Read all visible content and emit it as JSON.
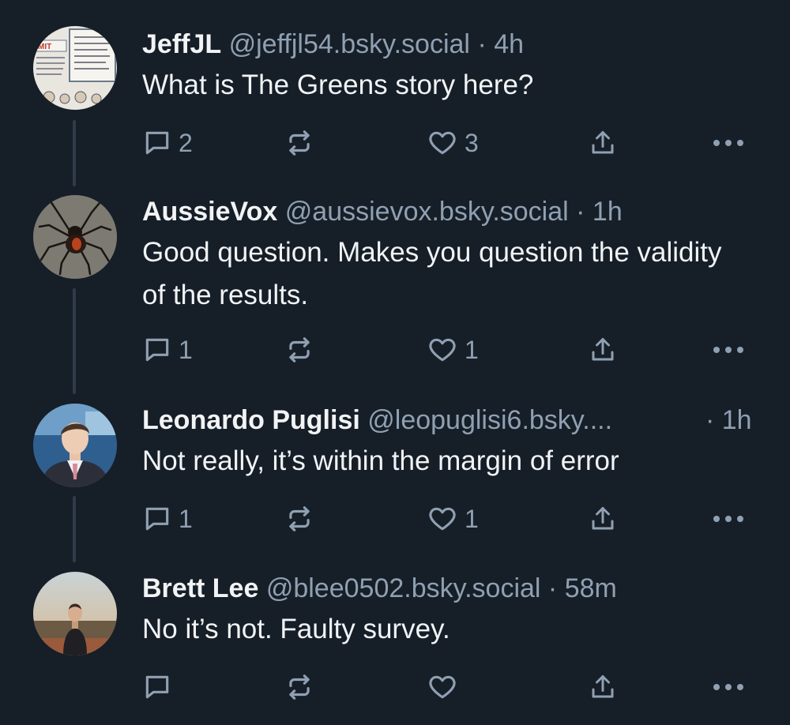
{
  "colors": {
    "background": "#161e27",
    "thread_line": "#2e3b4a",
    "text": "#f1f3f5",
    "muted": "#8fa0b2"
  },
  "posts": [
    {
      "name": "JeffJL",
      "handle": "@jeffjl54.bsky.social",
      "time": "· 4h",
      "text": "What is The Greens story here?",
      "replies": "2",
      "likes": "3",
      "avatar_icon": "cartoon-avatar"
    },
    {
      "name": "AussieVox",
      "handle": "@aussievox.bsky.social",
      "time": "· 1h",
      "text": "Good question. Makes you question the validity of the results.",
      "replies": "1",
      "likes": "1",
      "avatar_icon": "spider-avatar"
    },
    {
      "name": "Leonardo Puglisi",
      "handle": "@leopuglisi6.bsky....",
      "time": "· 1h",
      "text": "Not really, it’s within the margin of error",
      "replies": "1",
      "likes": "1",
      "avatar_icon": "person-suit-avatar"
    },
    {
      "name": "Brett Lee",
      "handle": "@blee0502.bsky.social",
      "time": "· 58m",
      "text": "No it’s not. Faulty survey.",
      "replies": "",
      "likes": "",
      "avatar_icon": "person-outdoor-avatar"
    }
  ],
  "icons": {
    "reply": "reply-icon",
    "repost": "repost-icon",
    "like": "heart-icon",
    "share": "share-icon",
    "more": "more-icon"
  }
}
